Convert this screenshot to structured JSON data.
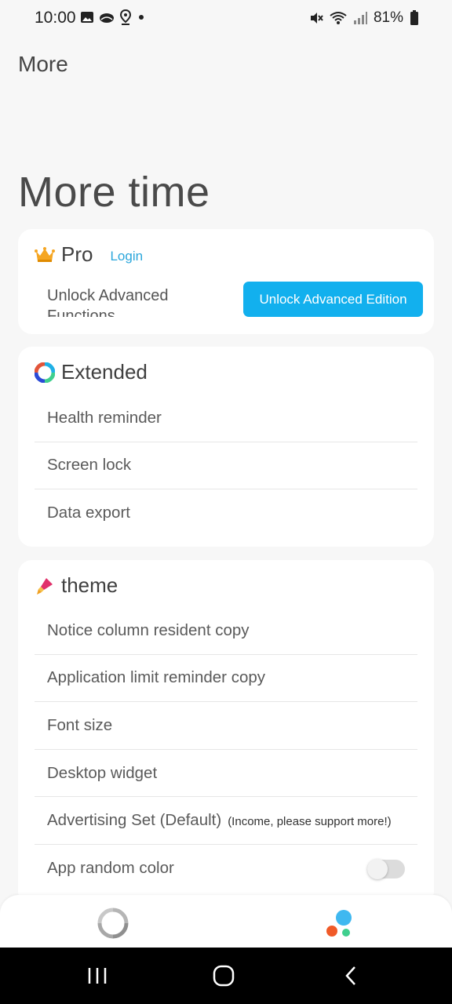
{
  "status_bar": {
    "time": "10:00",
    "battery": "81%",
    "left_icons": [
      "image-icon",
      "cloud-icon",
      "location-icon",
      "dot-icon"
    ],
    "right_icons": [
      "mute-icon",
      "wifi-icon",
      "signal-icon",
      "battery-icon"
    ]
  },
  "header": {
    "title": "More"
  },
  "hero": {
    "title": "More time"
  },
  "pro": {
    "icon": "crown-icon",
    "title": "Pro",
    "login_label": "Login",
    "description": "Unlock Advanced Functions",
    "unlock_button_label": "Unlock Advanced Edition"
  },
  "extended": {
    "icon": "ring-icon",
    "title": "Extended",
    "items": [
      "Health reminder",
      "Screen lock",
      "Data export"
    ]
  },
  "theme": {
    "icon": "brush-icon",
    "title": "theme",
    "items": [
      "Notice column resident copy",
      "Application limit reminder copy",
      "Font size",
      "Desktop widget",
      "Advertising Set (Default)",
      "App random color"
    ],
    "advertising_note": "(Income, please support more!)",
    "random_color_enabled": false
  },
  "bottom_nav": {
    "tabs": [
      {
        "name": "stats",
        "icon": "donut-icon"
      },
      {
        "name": "more",
        "icon": "dots-icon"
      }
    ]
  },
  "colors": {
    "accent": "#12b0ee",
    "link": "#2aa6db",
    "background": "#f7f7f7"
  }
}
